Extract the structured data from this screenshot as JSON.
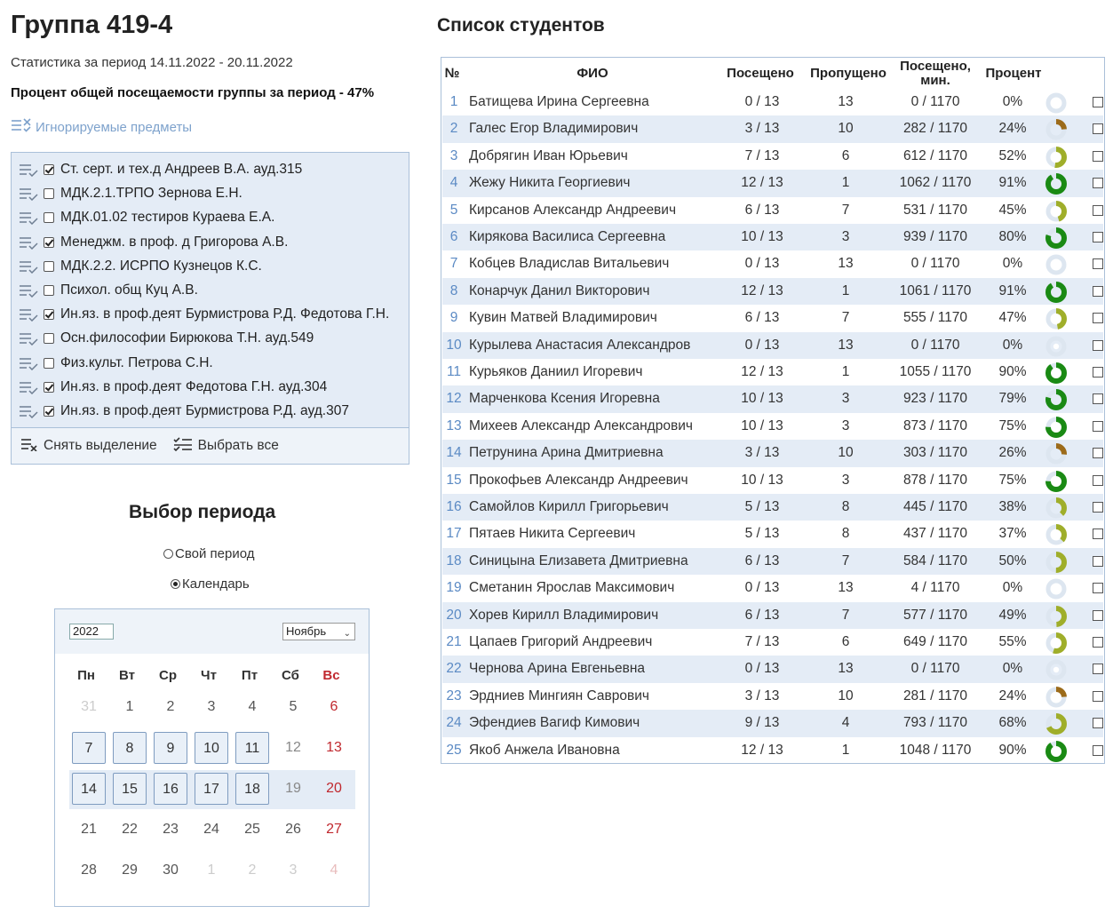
{
  "page": {
    "title": "Группа 419-4",
    "period_text": "Статистика за период 14.11.2022 - 20.11.2022",
    "percent_text": "Процент общей посещаемости группы за период - 47%",
    "ignored_link": "Игнорируемые предметы"
  },
  "subjects": [
    {
      "label": "Ст. серт. и тех.д Андреев В.А. ауд.315",
      "checked": true
    },
    {
      "label": "МДК.2.1.ТРПО Зернова Е.Н.",
      "checked": false
    },
    {
      "label": "МДК.01.02 тестиров Кураева Е.А.",
      "checked": false
    },
    {
      "label": "Менеджм. в проф. д Григорова А.В.",
      "checked": true
    },
    {
      "label": "МДК.2.2. ИСРПО Кузнецов К.С.",
      "checked": false
    },
    {
      "label": "Психол. общ Куц А.В.",
      "checked": false
    },
    {
      "label": "Ин.яз. в проф.деят Бурмистрова Р.Д. Федотова Г.Н.",
      "checked": true
    },
    {
      "label": "Осн.философии Бирюкова Т.Н. ауд.549",
      "checked": false
    },
    {
      "label": "Физ.культ. Петрова С.Н.",
      "checked": false
    },
    {
      "label": "Ин.яз. в проф.деят Федотова Г.Н. ауд.304",
      "checked": true
    },
    {
      "label": "Ин.яз. в проф.деят Бурмистрова Р.Д. ауд.307",
      "checked": true
    }
  ],
  "subject_footer": {
    "clear_label": "Снять выделение",
    "select_all_label": "Выбрать все"
  },
  "period": {
    "title": "Выбор периода",
    "options": [
      {
        "label": "Свой период",
        "selected": false
      },
      {
        "label": "Календарь",
        "selected": true
      }
    ]
  },
  "calendar": {
    "year": "2022",
    "month": "Ноябрь",
    "weekdays": [
      "Пн",
      "Вт",
      "Ср",
      "Чт",
      "Пт",
      "Сб",
      "Вс"
    ],
    "weeks": [
      [
        {
          "d": "31",
          "t": "muted"
        },
        {
          "d": "1",
          "t": "plain"
        },
        {
          "d": "2",
          "t": "plain"
        },
        {
          "d": "3",
          "t": "plain"
        },
        {
          "d": "4",
          "t": "plain"
        },
        {
          "d": "5",
          "t": "plain"
        },
        {
          "d": "6",
          "t": "sun"
        }
      ],
      [
        {
          "d": "7",
          "t": "btn"
        },
        {
          "d": "8",
          "t": "btn"
        },
        {
          "d": "9",
          "t": "btn"
        },
        {
          "d": "10",
          "t": "btn"
        },
        {
          "d": "11",
          "t": "btn"
        },
        {
          "d": "12",
          "t": "gray"
        },
        {
          "d": "13",
          "t": "sun"
        }
      ],
      [
        {
          "d": "14",
          "t": "btn"
        },
        {
          "d": "15",
          "t": "btn"
        },
        {
          "d": "16",
          "t": "btn"
        },
        {
          "d": "17",
          "t": "btn"
        },
        {
          "d": "18",
          "t": "btn"
        },
        {
          "d": "19",
          "t": "gray"
        },
        {
          "d": "20",
          "t": "sun"
        }
      ],
      [
        {
          "d": "21",
          "t": "plain"
        },
        {
          "d": "22",
          "t": "plain"
        },
        {
          "d": "23",
          "t": "plain"
        },
        {
          "d": "24",
          "t": "plain"
        },
        {
          "d": "25",
          "t": "plain"
        },
        {
          "d": "26",
          "t": "plain"
        },
        {
          "d": "27",
          "t": "sun"
        }
      ],
      [
        {
          "d": "28",
          "t": "plain"
        },
        {
          "d": "29",
          "t": "plain"
        },
        {
          "d": "30",
          "t": "plain"
        },
        {
          "d": "1",
          "t": "muted"
        },
        {
          "d": "2",
          "t": "muted"
        },
        {
          "d": "3",
          "t": "muted"
        },
        {
          "d": "4",
          "t": "sunmuted"
        }
      ]
    ]
  },
  "students": {
    "title": "Список студентов",
    "headers": {
      "num": "№",
      "fio": "ФИО",
      "visited": "Посещено",
      "skipped": "Пропущено",
      "minutes_line1": "Посещено,",
      "minutes_line2": "мин.",
      "percent": "Процент"
    },
    "colors": {
      "low": "#9c6b1a",
      "mid": "#9fae2a",
      "high": "#1a8a14",
      "ring_empty": "#dde6f0"
    },
    "rows": [
      {
        "num": "1",
        "fio": "Батищева Ирина Сергеевна",
        "visited": "0 / 13",
        "skipped": "13",
        "minutes": "0 / 1170",
        "percent": "0%",
        "pct": 0
      },
      {
        "num": "2",
        "fio": "Галес Егор Владимирович",
        "visited": "3 / 13",
        "skipped": "10",
        "minutes": "282 / 1170",
        "percent": "24%",
        "pct": 24
      },
      {
        "num": "3",
        "fio": "Добрягин Иван Юрьевич",
        "visited": "7 / 13",
        "skipped": "6",
        "minutes": "612 / 1170",
        "percent": "52%",
        "pct": 52
      },
      {
        "num": "4",
        "fio": "Жежу Никита Георгиевич",
        "visited": "12 / 13",
        "skipped": "1",
        "minutes": "1062 / 1170",
        "percent": "91%",
        "pct": 91
      },
      {
        "num": "5",
        "fio": "Кирсанов Александр Андреевич",
        "visited": "6 / 13",
        "skipped": "7",
        "minutes": "531 / 1170",
        "percent": "45%",
        "pct": 45
      },
      {
        "num": "6",
        "fio": "Кирякова Василиса Сергеевна",
        "visited": "10 / 13",
        "skipped": "3",
        "minutes": "939 / 1170",
        "percent": "80%",
        "pct": 80
      },
      {
        "num": "7",
        "fio": "Кобцев Владислав Витальевич",
        "visited": "0 / 13",
        "skipped": "13",
        "minutes": "0 / 1170",
        "percent": "0%",
        "pct": 0
      },
      {
        "num": "8",
        "fio": "Конарчук Данил Викторович",
        "visited": "12 / 13",
        "skipped": "1",
        "minutes": "1061 / 1170",
        "percent": "91%",
        "pct": 91
      },
      {
        "num": "9",
        "fio": "Кувин Матвей Владимирович",
        "visited": "6 / 13",
        "skipped": "7",
        "minutes": "555 / 1170",
        "percent": "47%",
        "pct": 47
      },
      {
        "num": "10",
        "fio": "Курылева Анастасия Александров",
        "visited": "0 / 13",
        "skipped": "13",
        "minutes": "0 / 1170",
        "percent": "0%",
        "pct": 0
      },
      {
        "num": "11",
        "fio": "Курьяков Даниил Игоревич",
        "visited": "12 / 13",
        "skipped": "1",
        "minutes": "1055 / 1170",
        "percent": "90%",
        "pct": 90
      },
      {
        "num": "12",
        "fio": "Марченкова Ксения Игоревна",
        "visited": "10 / 13",
        "skipped": "3",
        "minutes": "923 / 1170",
        "percent": "79%",
        "pct": 79
      },
      {
        "num": "13",
        "fio": "Михеев Александр Александрович",
        "visited": "10 / 13",
        "skipped": "3",
        "minutes": "873 / 1170",
        "percent": "75%",
        "pct": 75
      },
      {
        "num": "14",
        "fio": "Петрунина Арина Дмитриевна",
        "visited": "3 / 13",
        "skipped": "10",
        "minutes": "303 / 1170",
        "percent": "26%",
        "pct": 26
      },
      {
        "num": "15",
        "fio": "Прокофьев Александр Андреевич",
        "visited": "10 / 13",
        "skipped": "3",
        "minutes": "878 / 1170",
        "percent": "75%",
        "pct": 75
      },
      {
        "num": "16",
        "fio": "Самойлов Кирилл Григорьевич",
        "visited": "5 / 13",
        "skipped": "8",
        "minutes": "445 / 1170",
        "percent": "38%",
        "pct": 38
      },
      {
        "num": "17",
        "fio": "Пятаев Никита Сергеевич",
        "visited": "5 / 13",
        "skipped": "8",
        "minutes": "437 / 1170",
        "percent": "37%",
        "pct": 37
      },
      {
        "num": "18",
        "fio": "Синицына Елизавета Дмитриевна",
        "visited": "6 / 13",
        "skipped": "7",
        "minutes": "584 / 1170",
        "percent": "50%",
        "pct": 50
      },
      {
        "num": "19",
        "fio": "Сметанин Ярослав Максимович",
        "visited": "0 / 13",
        "skipped": "13",
        "minutes": "4 / 1170",
        "percent": "0%",
        "pct": 0
      },
      {
        "num": "20",
        "fio": "Хорев Кирилл Владимирович",
        "visited": "6 / 13",
        "skipped": "7",
        "minutes": "577 / 1170",
        "percent": "49%",
        "pct": 49
      },
      {
        "num": "21",
        "fio": "Цапаев Григорий Андреевич",
        "visited": "7 / 13",
        "skipped": "6",
        "minutes": "649 / 1170",
        "percent": "55%",
        "pct": 55
      },
      {
        "num": "22",
        "fio": "Чернова Арина Евгеньевна",
        "visited": "0 / 13",
        "skipped": "13",
        "minutes": "0 / 1170",
        "percent": "0%",
        "pct": 0
      },
      {
        "num": "23",
        "fio": "Эрдниев Мингиян Саврович",
        "visited": "3 / 13",
        "skipped": "10",
        "minutes": "281 / 1170",
        "percent": "24%",
        "pct": 24
      },
      {
        "num": "24",
        "fio": "Эфендиев Вагиф Кимович",
        "visited": "9 / 13",
        "skipped": "4",
        "minutes": "793 / 1170",
        "percent": "68%",
        "pct": 68
      },
      {
        "num": "25",
        "fio": "Якоб Анжела Ивановна",
        "visited": "12 / 13",
        "skipped": "1",
        "minutes": "1048 / 1170",
        "percent": "90%",
        "pct": 90
      }
    ]
  }
}
